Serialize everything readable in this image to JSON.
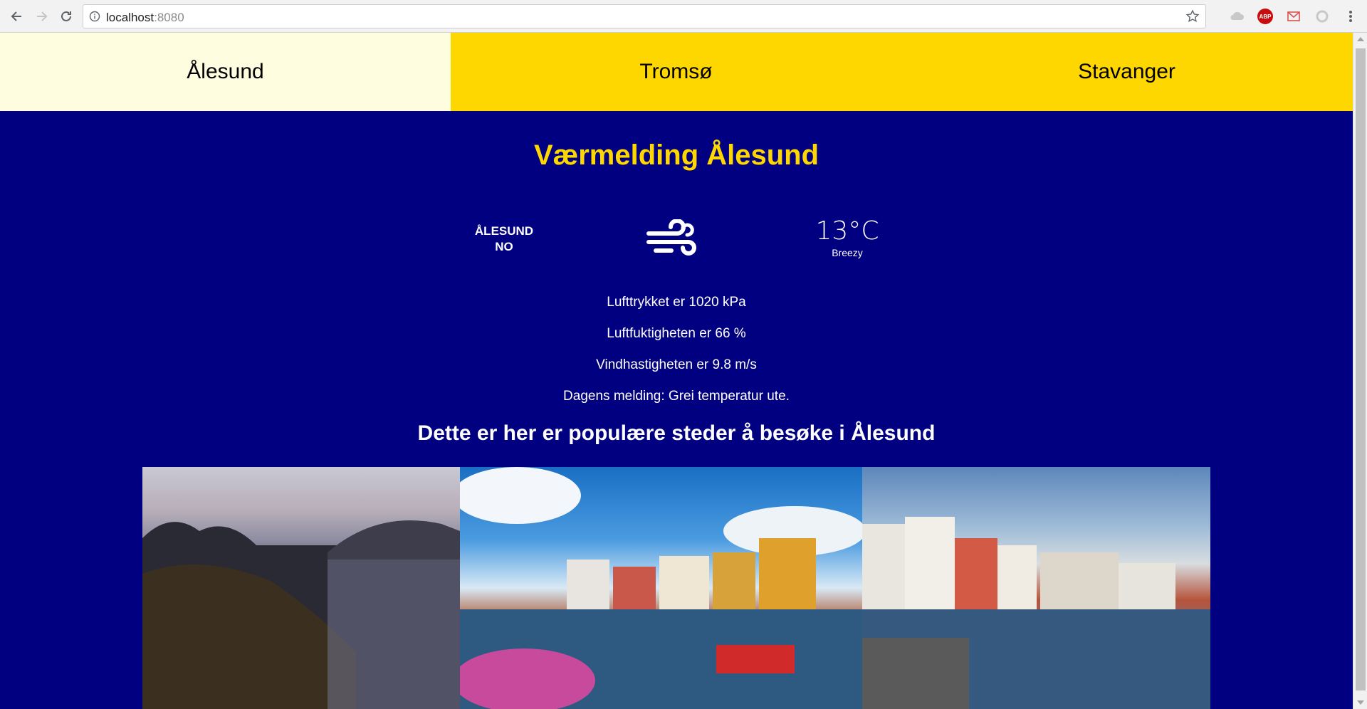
{
  "browser": {
    "url_host": "localhost",
    "url_port": ":8080"
  },
  "tabs": [
    {
      "label": "Ålesund",
      "active": true
    },
    {
      "label": "Tromsø",
      "active": false
    },
    {
      "label": "Stavanger",
      "active": false
    }
  ],
  "page": {
    "title": "Værmelding Ålesund",
    "location": {
      "city": "ÅLESUND",
      "country": "NO"
    },
    "weather_icon": "wind-icon",
    "temperature": "13°C",
    "condition": "Breezy",
    "details": [
      "Lufttrykket er 1020 kPa",
      "Luftfuktigheten er 66 %",
      "Vindhastigheten er 9.8 m/s",
      "Dagens melding: Grei temperatur ute."
    ],
    "subtitle": "Dette er her er populære steder å besøke i Ålesund"
  },
  "colors": {
    "background": "#000080",
    "accent": "#ffd700",
    "active_tab": "#fffde0"
  }
}
